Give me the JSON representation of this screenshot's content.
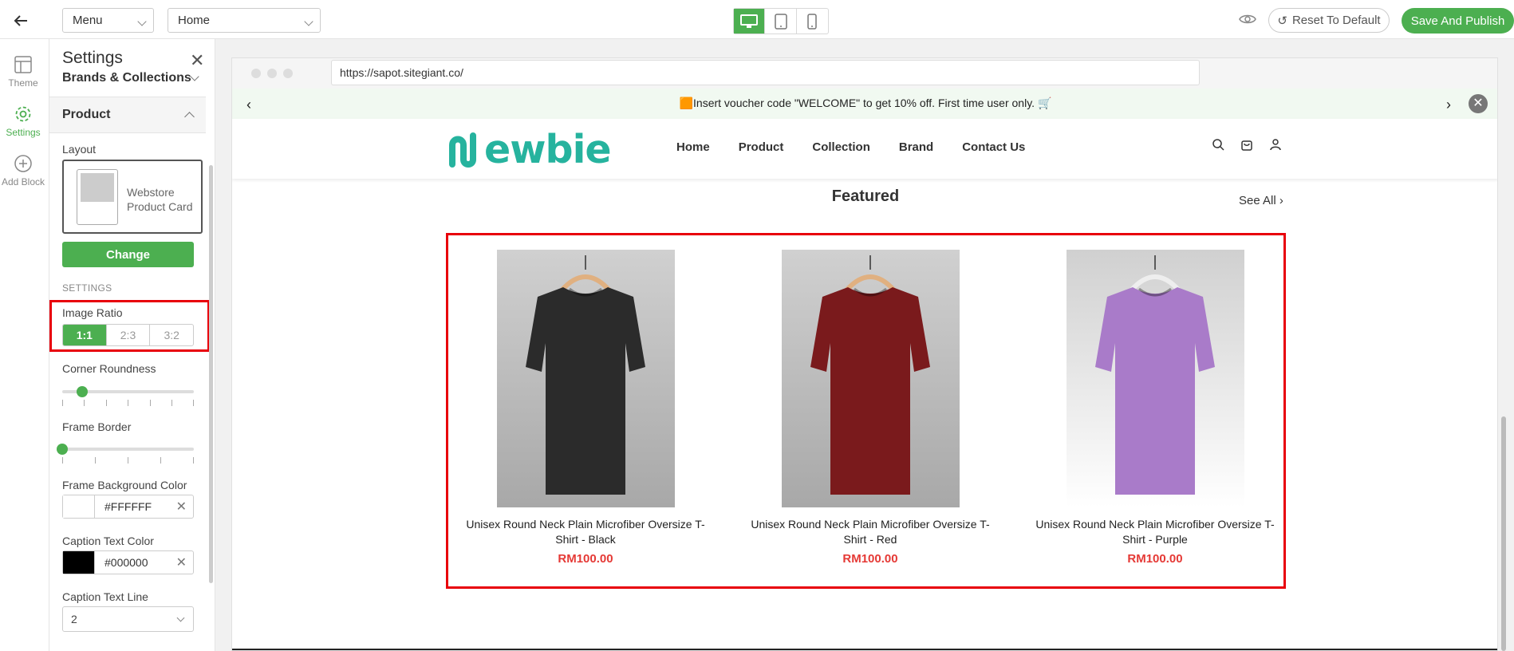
{
  "toolbar": {
    "menu_select": "Menu",
    "page_select": "Home",
    "reset_label": "Reset To Default",
    "publish_label": "Save And Publish",
    "devices": [
      "desktop-icon",
      "tablet-icon",
      "mobile-icon"
    ],
    "active_device": "desktop"
  },
  "rail": {
    "items": [
      {
        "label": "Theme",
        "icon": "theme-icon"
      },
      {
        "label": "Settings",
        "icon": "gear-icon",
        "active": true
      },
      {
        "label": "Add Block",
        "icon": "plus-circle-icon"
      }
    ]
  },
  "panel": {
    "title": "Settings",
    "brands_section": "Brands & Collections",
    "product_section": "Product",
    "layout_label": "Layout",
    "layout_name": "Webstore Product Card",
    "change_label": "Change",
    "settings_header": "SETTINGS",
    "image_ratio_label": "Image Ratio",
    "ratios": [
      "1:1",
      "2:3",
      "3:2"
    ],
    "selected_ratio": "1:1",
    "corner_label": "Corner Roundness",
    "corner_value": 0.15,
    "frame_border_label": "Frame Border",
    "frame_border_value": 0,
    "frame_bg_label": "Frame Background Color",
    "frame_bg_value": "#FFFFFF",
    "caption_color_label": "Caption Text Color",
    "caption_color_value": "#000000",
    "caption_line_label": "Caption Text Line",
    "caption_line_value": "2"
  },
  "preview": {
    "url": "https://sapot.sitegiant.co/",
    "announcement": "🟧Insert voucher code \"WELCOME\" to get 10% off. First time user only. 🛒",
    "logo": "ewbie",
    "nav": [
      "Home",
      "Product",
      "Collection",
      "Brand",
      "Contact Us"
    ],
    "section_title": "Featured",
    "see_all": "See All ›",
    "products": [
      {
        "name": "Unisex Round Neck Plain Microfiber Oversize T-Shirt - Black",
        "price": "RM100.00",
        "color": "#2b2b2b"
      },
      {
        "name": "Unisex Round Neck Plain Microfiber Oversize T-Shirt - Red",
        "price": "RM100.00",
        "color": "#7a1a1c"
      },
      {
        "name": "Unisex Round Neck Plain Microfiber Oversize T-Shirt - Purple",
        "price": "RM100.00",
        "color": "#a97bc9"
      }
    ]
  },
  "colors": {
    "accent": "#4caf50",
    "price": "#e53935",
    "highlight": "#e8000b"
  }
}
